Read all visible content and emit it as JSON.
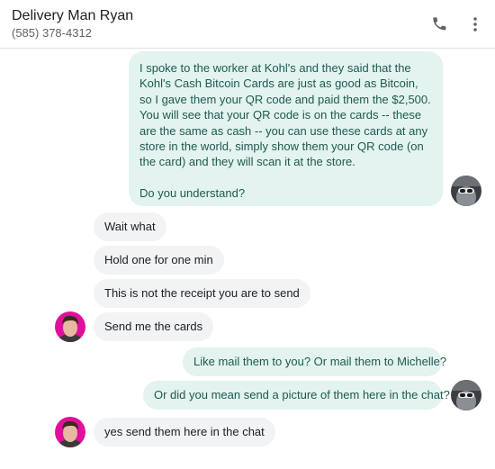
{
  "header": {
    "contact_name": "Delivery Man Ryan",
    "contact_phone": "(585) 378-4312",
    "call_icon": "phone-icon",
    "menu_icon": "more-vert-icon"
  },
  "messages": [
    {
      "direction": "outgoing",
      "paragraphs": [
        "I spoke to the worker at Kohl's and they said that the Kohl's Cash Bitcoin Cards are just as good as Bitcoin, so I gave them your QR code and paid them the $2,500. You will see that your QR code is on the cards -- these are the same as cash -- you can use these cards at any store in the world, simply show them your QR code (on the card) and they will scan it at the store.",
        "Do you understand?"
      ]
    },
    {
      "direction": "incoming",
      "text": "Wait what"
    },
    {
      "direction": "incoming",
      "text": "Hold one for one min"
    },
    {
      "direction": "incoming",
      "text": "This is not the receipt you are to send"
    },
    {
      "direction": "incoming",
      "text": "Send me the cards"
    },
    {
      "direction": "outgoing",
      "text": "Like mail them to you? Or mail them to Michelle?"
    },
    {
      "direction": "outgoing",
      "text": "Or did you mean send a picture of them here in the chat?"
    },
    {
      "direction": "incoming",
      "text": "yes send them here in the chat"
    }
  ],
  "colors": {
    "outgoing_bubble": "#e3f3ef",
    "outgoing_text": "#1e5a4f",
    "incoming_bubble": "#f1f3f4",
    "incoming_avatar_bg": "#e0109c"
  }
}
